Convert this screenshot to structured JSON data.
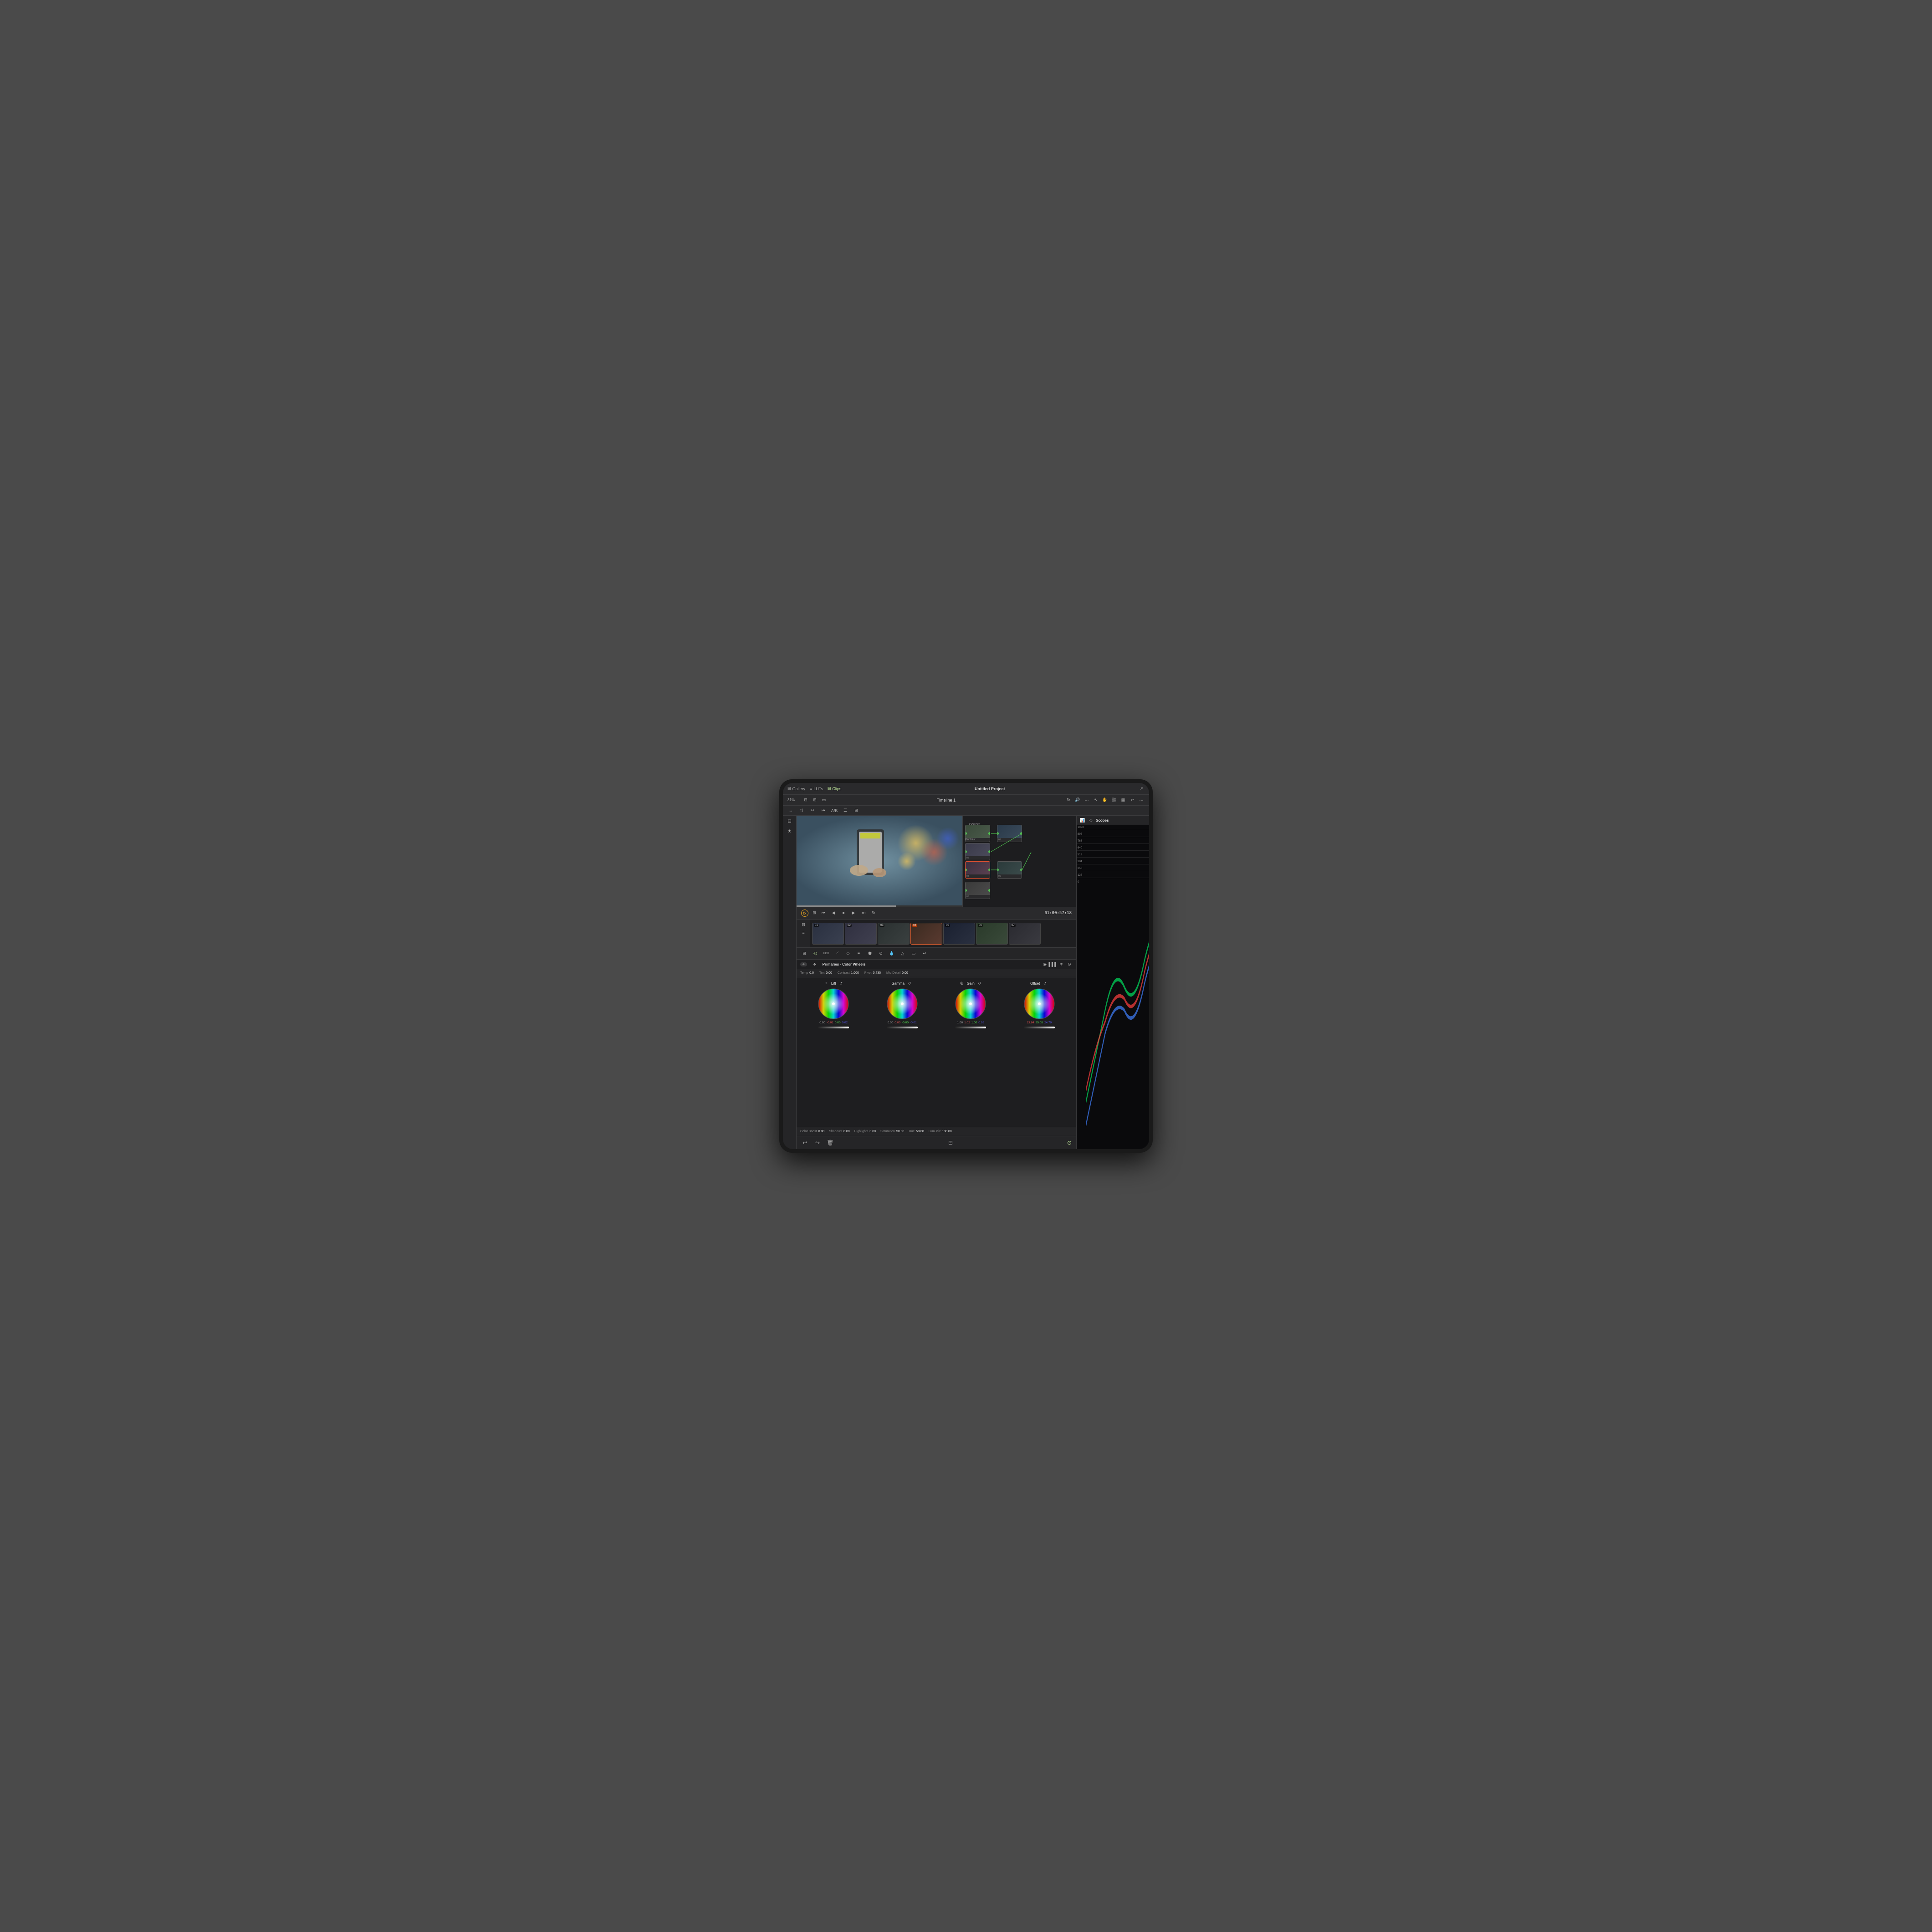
{
  "app": {
    "title": "Untitled Project"
  },
  "top_nav": {
    "items": [
      {
        "label": "Gallery",
        "active": false
      },
      {
        "label": "LUTs",
        "active": false
      },
      {
        "label": "Clips",
        "active": true
      }
    ]
  },
  "toolbar": {
    "zoom": "31%",
    "timeline_name": "Timeline 1",
    "timecode": "01:00:57:18"
  },
  "node_graph": {
    "label": "Correct",
    "nodes": [
      {
        "id": "01",
        "active": false
      },
      {
        "id": "02",
        "active": false,
        "label": "Contrast"
      },
      {
        "id": "03",
        "active": false
      },
      {
        "id": "04",
        "active": true
      },
      {
        "id": "05",
        "active": false
      },
      {
        "id": "06",
        "active": false
      }
    ]
  },
  "timeline": {
    "strips": [
      {
        "number": "01",
        "active": false
      },
      {
        "number": "02",
        "active": false
      },
      {
        "number": "03",
        "active": false
      },
      {
        "number": "04",
        "active": true
      },
      {
        "number": "05",
        "active": false
      },
      {
        "number": "06",
        "active": false
      },
      {
        "number": "07",
        "active": false
      }
    ]
  },
  "color_section": {
    "title": "Primaries - Color Wheels",
    "params": {
      "temp_label": "Temp",
      "temp_value": "0.0",
      "tint_label": "Tint",
      "tint_value": "0.00",
      "contrast_label": "Contrast",
      "contrast_value": "1.000",
      "pivot_label": "Pivot",
      "pivot_value": "0.435",
      "mid_detail_label": "Mid Detail",
      "mid_detail_value": "0.00"
    },
    "wheels": [
      {
        "label": "Lift",
        "values": [
          "0.00",
          "-0.01",
          "0.00",
          "0.02"
        ],
        "colors": [
          "white",
          "red",
          "green",
          "blue"
        ]
      },
      {
        "label": "Gamma",
        "values": [
          "0.00",
          "0.00",
          "-0.00",
          "-0.01"
        ],
        "colors": [
          "white",
          "red",
          "green",
          "blue"
        ]
      },
      {
        "label": "Gain",
        "values": [
          "1.00",
          "1.02",
          "1.00",
          "0.95"
        ],
        "colors": [
          "white",
          "red",
          "green",
          "blue"
        ]
      },
      {
        "label": "Offset",
        "values": [
          "23.84",
          "25.08",
          "24.79"
        ],
        "colors": [
          "red",
          "green",
          "blue"
        ]
      }
    ],
    "bottom_params": {
      "color_boost_label": "Color Boost",
      "color_boost_value": "0.00",
      "shadows_label": "Shadows",
      "shadows_value": "0.00",
      "highlights_label": "Highlights",
      "highlights_value": "0.00",
      "saturation_label": "Saturation",
      "saturation_value": "50.00",
      "hue_label": "Hue",
      "hue_value": "50.00",
      "lum_mix_label": "Lum Mix",
      "lum_mix_value": "100.00"
    }
  },
  "scopes": {
    "title": "Scopes",
    "scale_labels": [
      "1023",
      "896",
      "768",
      "640",
      "512",
      "384",
      "256",
      "128",
      "0"
    ]
  }
}
